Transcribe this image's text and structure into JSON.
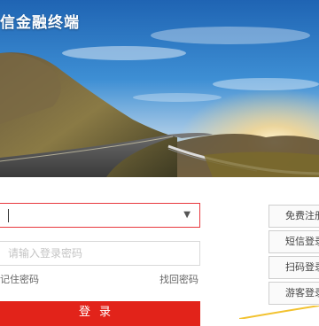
{
  "app": {
    "title": "信金融终端"
  },
  "login": {
    "account_value": "",
    "password_placeholder": "请输入登录密码",
    "remember_label": "记住密码",
    "retrieve_label": "找回密码",
    "submit_label": "登录"
  },
  "side_actions": [
    {
      "label": "免费注册"
    },
    {
      "label": "短信登录"
    },
    {
      "label": "扫码登录"
    },
    {
      "label": "游客登录"
    }
  ],
  "colors": {
    "accent": "#e2231a",
    "focus_border": "#e8383d"
  }
}
